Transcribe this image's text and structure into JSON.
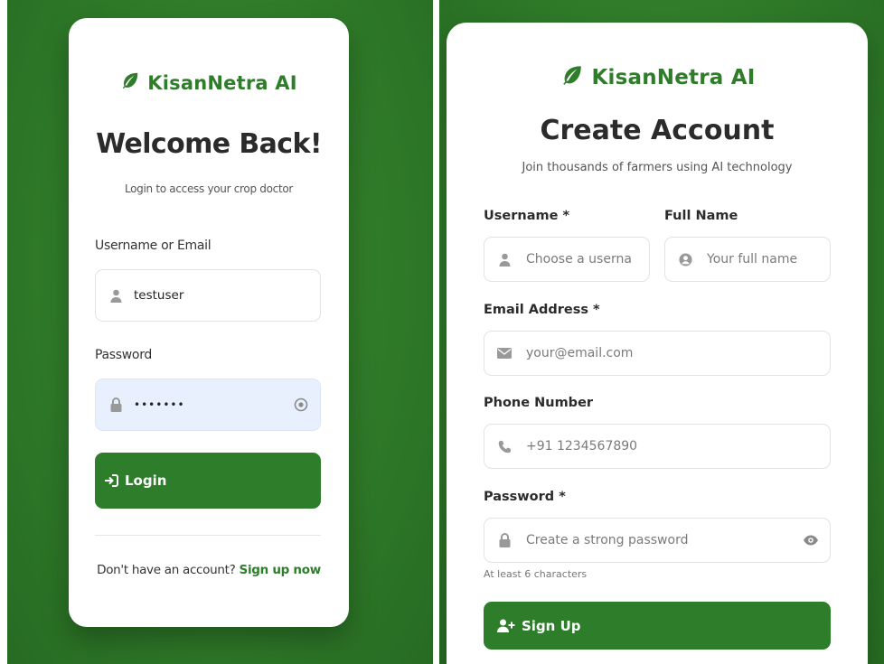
{
  "login": {
    "brand_name": "KisanNetra AI",
    "title": "Welcome Back!",
    "subtitle": "Login to access your crop doctor",
    "username_label": "Username or Email",
    "username_value": "testuser",
    "password_label": "Password",
    "password_value": "•••••••",
    "login_button": "Login",
    "footer_prompt": "Don't have an account?",
    "signup_link": "Sign up now"
  },
  "signup": {
    "brand_name": "KisanNetra AI",
    "title": "Create Account",
    "subtitle": "Join thousands of farmers using AI technology",
    "username_label": "Username *",
    "username_placeholder": "Choose a userna",
    "fullname_label": "Full Name",
    "fullname_placeholder": "Your full name",
    "email_label": "Email Address *",
    "email_placeholder": "your@email.com",
    "phone_label": "Phone Number",
    "phone_placeholder": "+91 1234567890",
    "password_label": "Password *",
    "password_placeholder": "Create a strong password",
    "password_hint": "At least 6 characters",
    "signup_button": "Sign Up"
  },
  "colors": {
    "brand_green": "#2e7d2b",
    "background_green": "#2f7a29",
    "autofill_blue": "#e8f0fe"
  },
  "icons": {
    "brand": "leaf-icon",
    "user": "user-icon",
    "user_circle": "user-circle-icon",
    "lock": "lock-icon",
    "eye": "eye-icon",
    "envelope": "envelope-icon",
    "phone": "phone-icon",
    "login": "sign-in-icon",
    "user_plus": "user-plus-icon"
  }
}
